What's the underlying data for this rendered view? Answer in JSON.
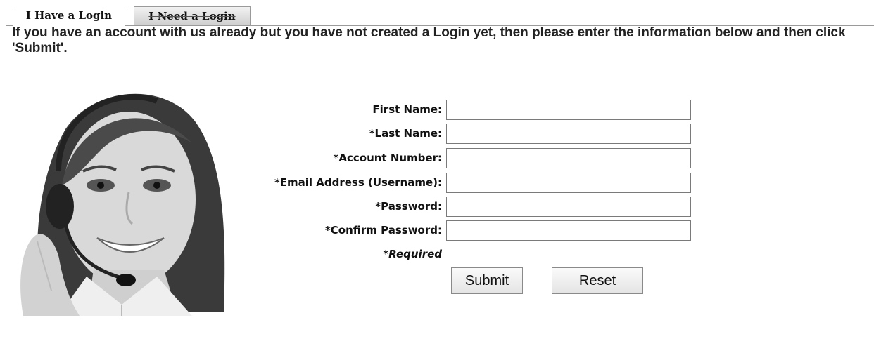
{
  "tabs": [
    {
      "label": "I Have a Login",
      "active": true
    },
    {
      "label": "I Need a Login",
      "active": false
    }
  ],
  "intro_text": "If you have an account with us already but you have not created a Login yet, then please enter the information below and then click 'Submit'.",
  "form": {
    "fields": [
      {
        "label": "First Name:",
        "value": ""
      },
      {
        "label": "*Last Name:",
        "value": ""
      },
      {
        "label": "*Account Number:",
        "value": ""
      },
      {
        "label": "*Email Address (Username):",
        "value": ""
      },
      {
        "label": "*Password:",
        "value": ""
      },
      {
        "label": "*Confirm Password:",
        "value": ""
      }
    ],
    "required_note": "*Required",
    "submit_label": "Submit",
    "reset_label": "Reset"
  },
  "colors": {
    "border": "#9a9a9a",
    "tab_inactive_top": "#f2f2f2",
    "tab_inactive_bottom": "#cfcfcf"
  }
}
